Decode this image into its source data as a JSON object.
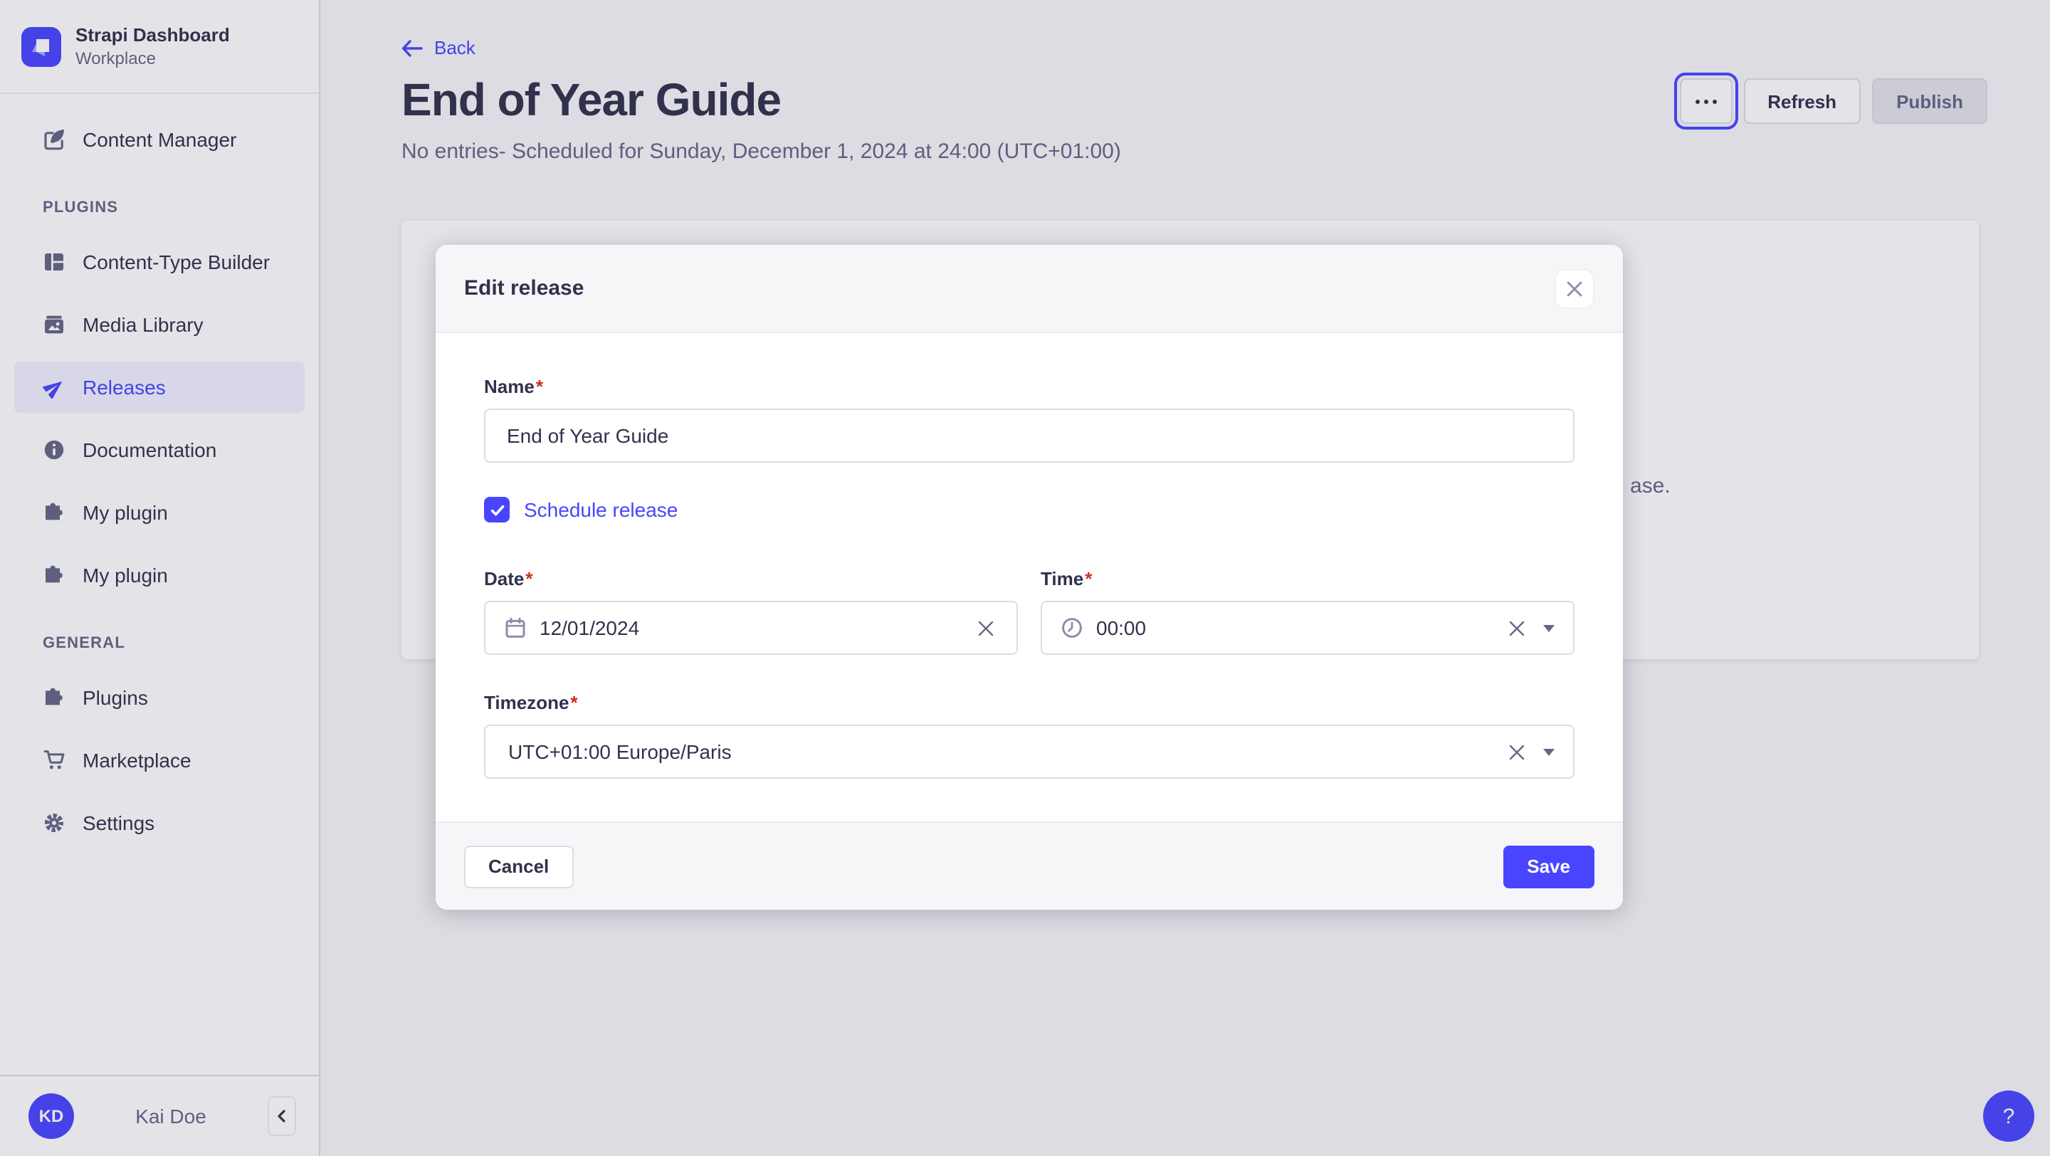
{
  "colors": {
    "primary": "#4945ff",
    "title_text": "#32324d",
    "muted_text": "#666687",
    "border": "#dcdce4",
    "danger": "#d02b20",
    "active_item_bg": "#f0f0ff"
  },
  "sidebar": {
    "brand": {
      "title": "Strapi Dashboard",
      "subtitle": "Workplace",
      "logo_icon": "strapi-logo"
    },
    "top_items": [
      {
        "label": "Content Manager",
        "icon": "content-manager-icon"
      }
    ],
    "sections": [
      {
        "label": "PLUGINS",
        "items": [
          {
            "label": "Content-Type Builder",
            "icon": "content-type-builder-icon",
            "active": false
          },
          {
            "label": "Media Library",
            "icon": "media-library-icon",
            "active": false
          },
          {
            "label": "Releases",
            "icon": "paper-plane-icon",
            "active": true
          },
          {
            "label": "Documentation",
            "icon": "info-circle-icon",
            "active": false
          },
          {
            "label": "My plugin",
            "icon": "puzzle-icon",
            "active": false
          },
          {
            "label": "My plugin",
            "icon": "puzzle-icon",
            "active": false
          }
        ]
      },
      {
        "label": "GENERAL",
        "items": [
          {
            "label": "Plugins",
            "icon": "puzzle-icon",
            "active": false
          },
          {
            "label": "Marketplace",
            "icon": "cart-icon",
            "active": false
          },
          {
            "label": "Settings",
            "icon": "gear-icon",
            "active": false
          }
        ]
      }
    ],
    "user": {
      "initials": "KD",
      "name": "Kai Doe"
    }
  },
  "header": {
    "back_label": "Back",
    "title": "End of Year Guide",
    "subtitle": "No entries- Scheduled for Sunday, December 1, 2024 at 24:00 (UTC+01:00)",
    "actions": {
      "more_icon": "ellipsis-icon",
      "refresh_label": "Refresh",
      "publish_label": "Publish",
      "publish_disabled": true
    }
  },
  "background_card": {
    "visible_text_fragment": "ase."
  },
  "modal": {
    "title": "Edit release",
    "fields": {
      "name": {
        "label": "Name",
        "required_mark": "*",
        "value": "End of Year Guide"
      },
      "schedule": {
        "label": "Schedule release",
        "checked": true
      },
      "date": {
        "label": "Date",
        "required_mark": "*",
        "value": "12/01/2024"
      },
      "time": {
        "label": "Time",
        "required_mark": "*",
        "value": "00:00"
      },
      "timezone": {
        "label": "Timezone",
        "required_mark": "*",
        "value": "UTC+01:00 Europe/Paris"
      }
    },
    "cancel_label": "Cancel",
    "save_label": "Save"
  },
  "help_button": {
    "label": "?"
  }
}
